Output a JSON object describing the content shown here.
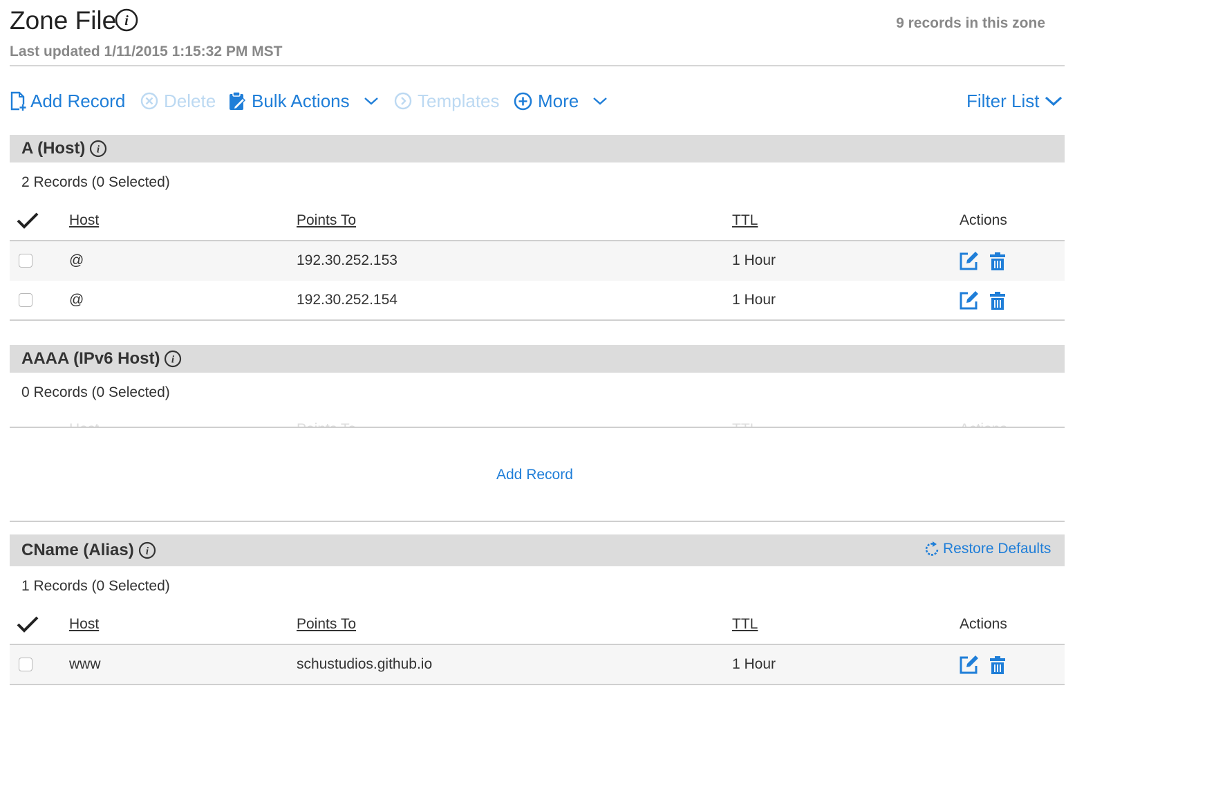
{
  "header": {
    "title": "Zone File",
    "record_count": "9 records in this zone",
    "last_updated": "Last updated 1/11/2015 1:15:32 PM MST"
  },
  "toolbar": {
    "add_record": "Add Record",
    "delete": "Delete",
    "bulk_actions": "Bulk Actions",
    "templates": "Templates",
    "more": "More",
    "filter_list": "Filter List"
  },
  "columns": {
    "host": "Host",
    "points_to": "Points To",
    "ttl": "TTL",
    "actions": "Actions"
  },
  "sections": {
    "a": {
      "title": "A (Host)",
      "subtitle": "2 Records (0 Selected)",
      "rows": [
        {
          "host": "@",
          "points_to": "192.30.252.153",
          "ttl": "1 Hour"
        },
        {
          "host": "@",
          "points_to": "192.30.252.154",
          "ttl": "1 Hour"
        }
      ]
    },
    "aaaa": {
      "title": "AAAA (IPv6 Host)",
      "subtitle": "0 Records (0 Selected)",
      "add_record": "Add Record"
    },
    "cname": {
      "title": "CName (Alias)",
      "subtitle": "1 Records (0 Selected)",
      "restore_defaults": "Restore Defaults",
      "rows": [
        {
          "host": "www",
          "points_to": "schustudios.github.io",
          "ttl": "1 Hour"
        }
      ]
    }
  },
  "colors": {
    "accent": "#1f7ed8",
    "accent_disabled": "#bcd9f2",
    "section_bg": "#dcdcdc",
    "muted_text": "#888888"
  }
}
